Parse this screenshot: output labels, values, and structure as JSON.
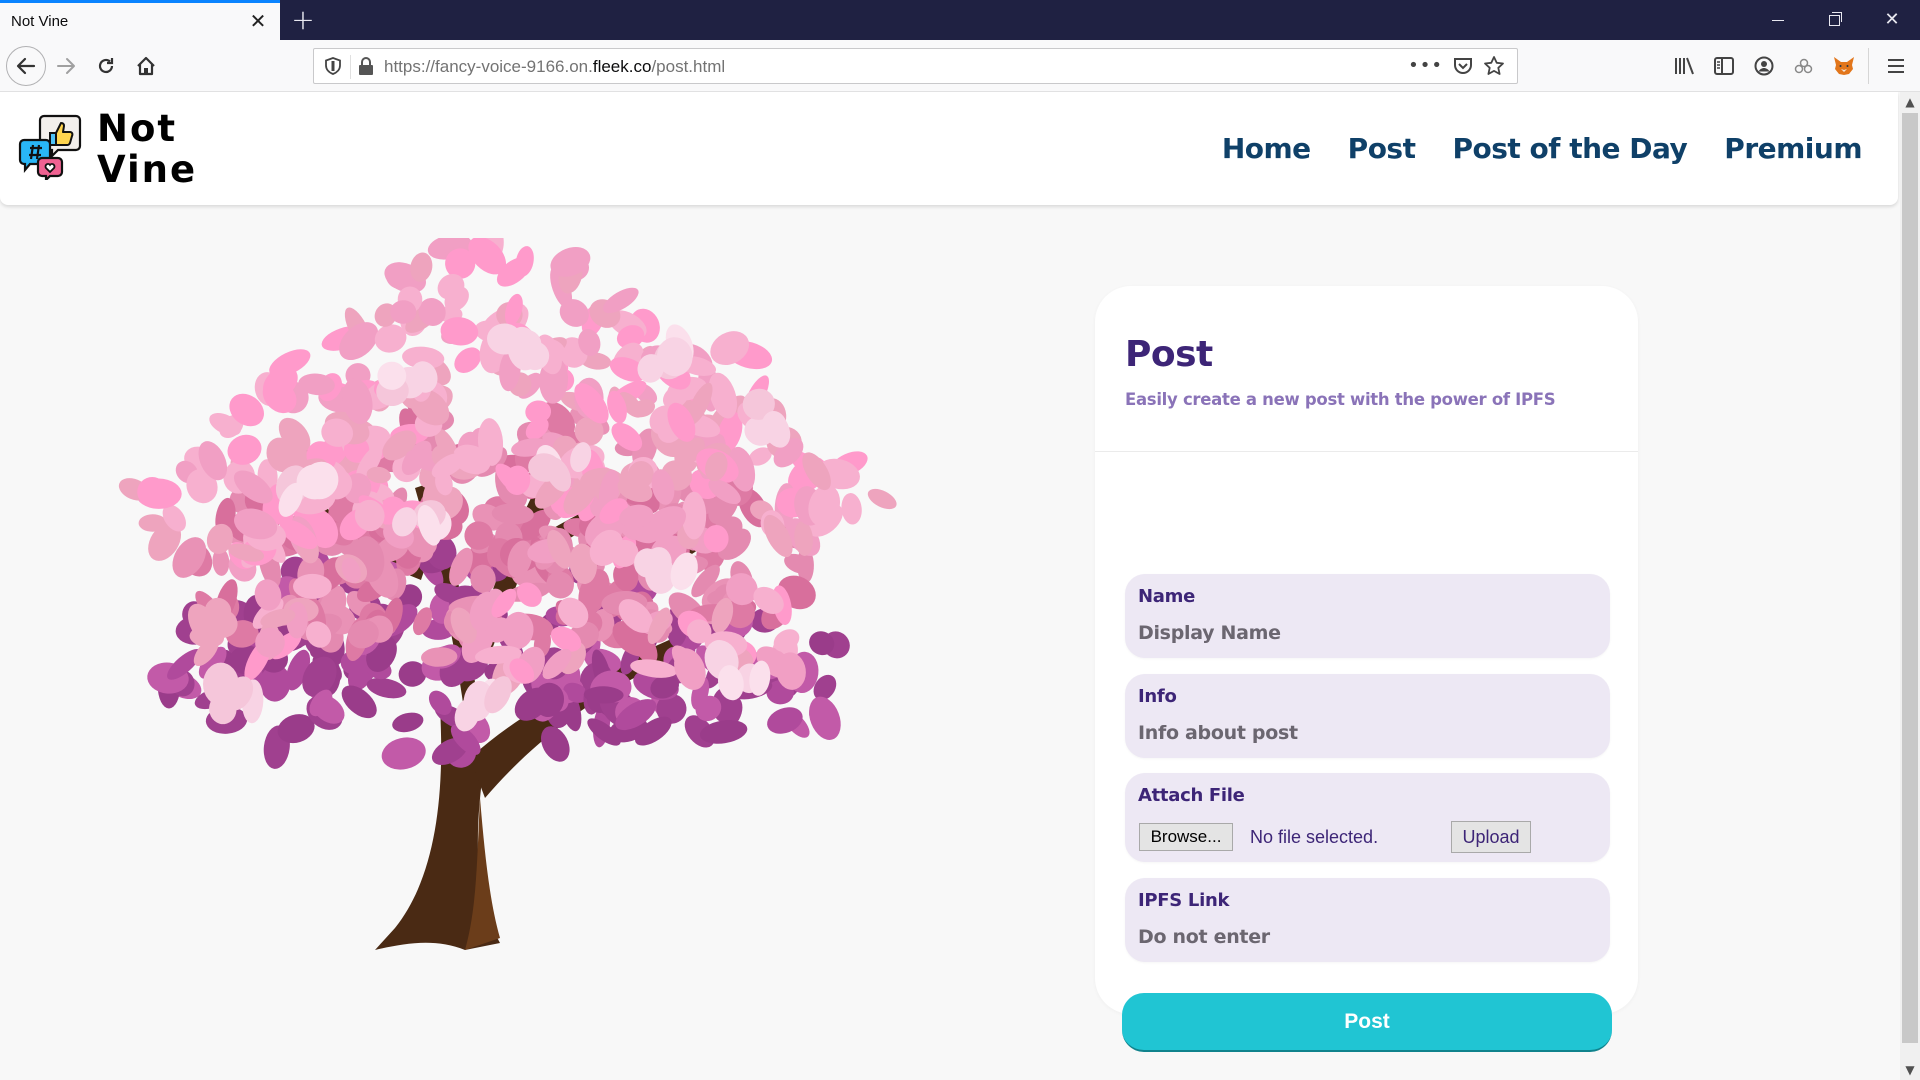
{
  "browser": {
    "tab_title": "Not Vine",
    "url_prefix": "https://fancy-voice-9166.on.",
    "url_host": "fleek.co",
    "url_path": "/post.html",
    "accent": "#0a84ff"
  },
  "site": {
    "logo_line1": "Not",
    "logo_line2": "Vine",
    "nav": [
      {
        "label": "Home"
      },
      {
        "label": "Post"
      },
      {
        "label": "Post of the Day"
      },
      {
        "label": "Premium"
      }
    ],
    "nav_color": "#0f4068"
  },
  "form": {
    "title": "Post",
    "subtitle": "Easily create a new post with the power of IPFS",
    "fields": [
      {
        "label": "Name",
        "placeholder": "Display Name",
        "value": ""
      },
      {
        "label": "Info",
        "placeholder": "Info about post",
        "value": ""
      },
      {
        "label": "Attach File",
        "browse_label": "Browse...",
        "status": "No file selected.",
        "upload_label": "Upload"
      },
      {
        "label": "IPFS Link",
        "placeholder": "Do not enter",
        "value": ""
      }
    ],
    "submit_label": "Post",
    "colors": {
      "title": "#3d2577",
      "subtitle": "#8a73b8",
      "field_bg": "#ede8f4",
      "button": "#20c5d3"
    }
  },
  "illustration": {
    "subject": "cherry-blossom-tree"
  }
}
